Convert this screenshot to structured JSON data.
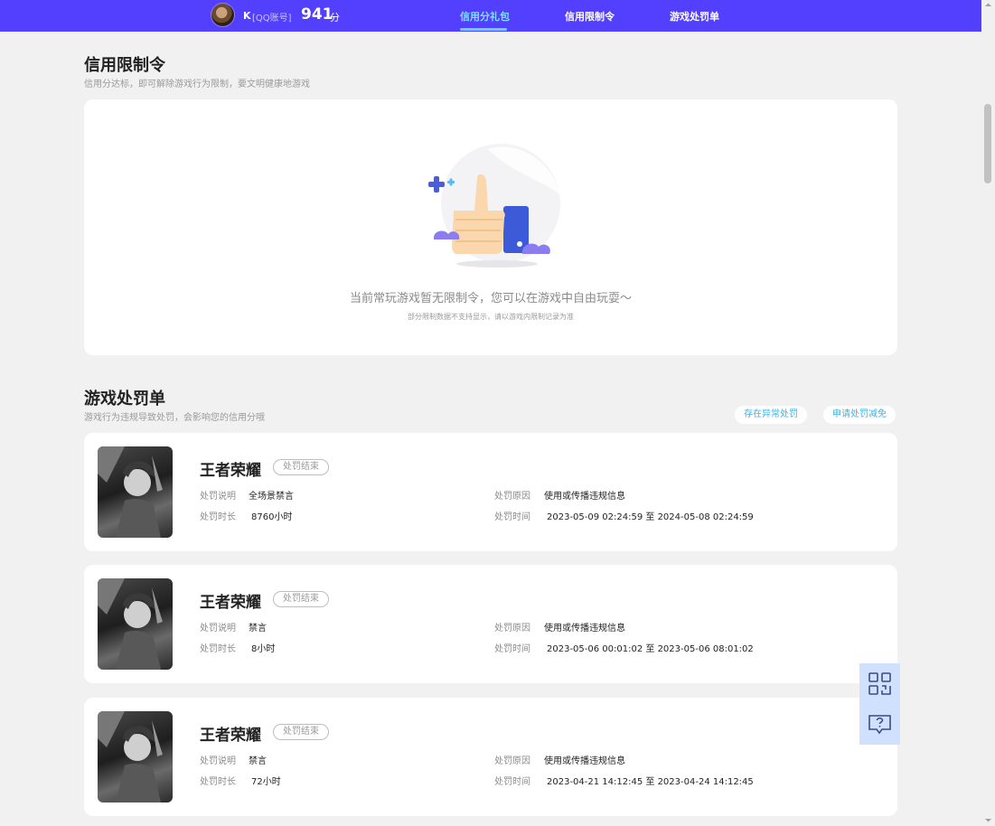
{
  "header": {
    "user_initial": "K",
    "account_type": "[QQ账号]",
    "score": "941",
    "score_unit": "分",
    "tabs": [
      {
        "label": "信用分礼包",
        "active": true
      },
      {
        "label": "信用限制令",
        "active": false
      },
      {
        "label": "游戏处罚单",
        "active": false
      }
    ]
  },
  "restrictions": {
    "title": "信用限制令",
    "subtitle": "信用分达标，即可解除游戏行为限制，要文明健康地游戏",
    "empty_message": "当前常玩游戏暂无限制令，您可以在游戏中自由玩耍～",
    "empty_note": "部分限制数据不支持显示，请以游戏内限制记录为准"
  },
  "penalties": {
    "title": "游戏处罚单",
    "subtitle": "游戏行为违规导致处罚，会影响您的信用分哦",
    "button_abnormal": "存在异常处罚",
    "button_reduce": "申请处罚减免",
    "labels": {
      "desc": "处罚说明",
      "duration": "处罚时长",
      "reason": "处罚原因",
      "time": "处罚时间"
    },
    "items": [
      {
        "game": "王者荣耀",
        "status": "处罚结束",
        "desc": "全场景禁言",
        "duration": "8760小时",
        "reason": "使用或传播违规信息",
        "time": "2023-05-09 02:24:59 至 2024-05-08 02:24:59"
      },
      {
        "game": "王者荣耀",
        "status": "处罚结束",
        "desc": "禁言",
        "duration": "8小时",
        "reason": "使用或传播违规信息",
        "time": "2023-05-06 00:01:02 至 2023-05-06 08:01:02"
      },
      {
        "game": "王者荣耀",
        "status": "处罚结束",
        "desc": "禁言",
        "duration": "72小时",
        "reason": "使用或传播违规信息",
        "time": "2023-04-21 14:12:45 至 2023-04-24 14:12:45"
      }
    ]
  },
  "side_buttons": [
    {
      "icon": "qr-code-icon"
    },
    {
      "icon": "help-chat-icon"
    }
  ],
  "colors": {
    "brand": "#5340ff",
    "tab_active": "#7de0ff",
    "link": "#35b4ea",
    "side_button": "#cfe1ff"
  }
}
